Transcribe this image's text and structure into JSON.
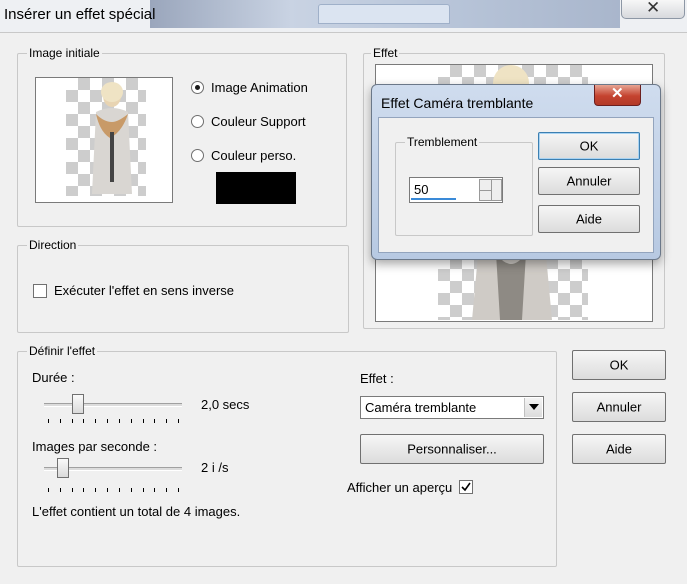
{
  "window": {
    "title": "Insérer un effet spécial",
    "close_glyph": "✕"
  },
  "initial_image": {
    "legend": "Image initiale",
    "options": [
      {
        "label": "Image Animation",
        "selected": true
      },
      {
        "label": "Couleur Support",
        "selected": false
      },
      {
        "label": "Couleur perso.",
        "selected": false
      }
    ],
    "custom_color": "#000000"
  },
  "preview": {
    "legend": "Effet"
  },
  "direction": {
    "legend": "Direction",
    "reverse_label": "Exécuter l'effet en sens inverse",
    "reverse_checked": false
  },
  "define": {
    "legend": "Définir l'effet",
    "duration_label": "Durée :",
    "duration_value": "2,0 secs",
    "duration_level": 0.22,
    "fps_label": "Images par seconde :",
    "fps_value": "2 i /s",
    "fps_level": 0.1,
    "effect_label": "Effet :",
    "effect_selected": "Caméra tremblante",
    "customize_label": "Personnaliser...",
    "preview_label": "Afficher un aperçu",
    "preview_checked": true,
    "total_text": "L'effet contient un total de 4 images."
  },
  "buttons": {
    "ok": "OK",
    "cancel": "Annuler",
    "help": "Aide"
  },
  "popup": {
    "title": "Effet Caméra tremblante",
    "close_glyph": "✕",
    "group_legend": "Tremblement",
    "value": "50",
    "value_level": 0.5,
    "ok": "OK",
    "cancel": "Annuler",
    "help": "Aide"
  },
  "icons": {
    "radio": "radio-icon",
    "check": "checkmark-icon",
    "spin_up": "spin-up-icon",
    "spin_down": "spin-down-icon",
    "dropdown": "chevron-down-icon"
  }
}
